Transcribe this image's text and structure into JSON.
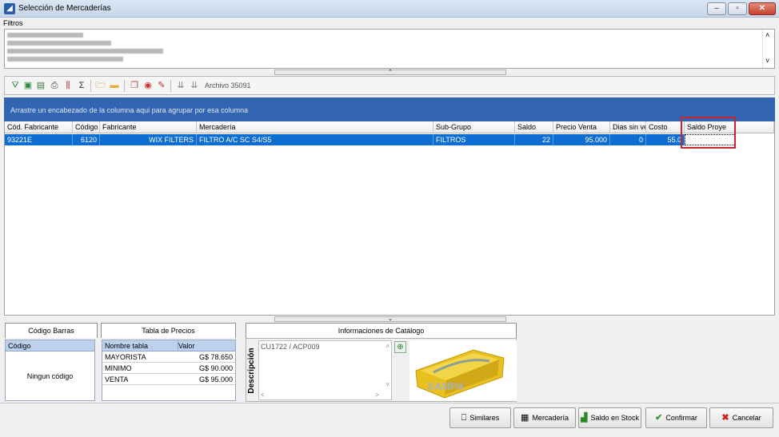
{
  "window": {
    "title": "Selección de Mercaderías"
  },
  "filters": {
    "label": "Filtros"
  },
  "toolbar": {
    "archivo": "Archivo 35091"
  },
  "group_panel": {
    "text": "Arrastre un encabezado de la columna aqui para agrupar por esa columna"
  },
  "grid": {
    "columns": [
      "Cód. Fabricante",
      "Código",
      "Fabricante",
      "Mercadería",
      "Sub-Grupo",
      "Saldo",
      "Precio Venta",
      "Dias sin ve",
      "Costo",
      "Saldo Proye"
    ],
    "rows": [
      {
        "cod_fabricante": "93221E",
        "codigo": "6120",
        "fabricante": "WIX FILTERS",
        "mercaderia": "FILTRO A/C SC S4/S5",
        "subgrupo": "FILTROS",
        "saldo": "22",
        "precio_venta": "95.000",
        "dias": "0",
        "costo": "55.0"
      }
    ]
  },
  "tabs": {
    "codigo_barras": "Código Barras",
    "tabla_precios": "Tabla de Precios",
    "info_catalogo": "Informaciones de Catálogo"
  },
  "barcode_panel": {
    "header": "Código",
    "empty": "Ningun código"
  },
  "prices_panel": {
    "headers": [
      "Nombre tabla",
      "Valor"
    ],
    "rows": [
      {
        "name": "MAYORISTA",
        "value": "G$ 78.650"
      },
      {
        "name": "MINIMO",
        "value": "G$ 90.000"
      },
      {
        "name": "VENTA",
        "value": "G$ 95.000"
      }
    ]
  },
  "catalog": {
    "desc_label": "Descripción",
    "desc_text": "CU1722 / ACP009",
    "logo_text": "SAMPA"
  },
  "buttons": {
    "similares": "Similares",
    "mercaderia": "Mercadería",
    "saldo_stock": "Saldo en Stock",
    "confirmar": "Confirmar",
    "cancelar": "Cancelar"
  },
  "colors": {
    "selection": "#0e6dd1",
    "group_panel": "#3465b3",
    "highlight": "#c8282d"
  }
}
